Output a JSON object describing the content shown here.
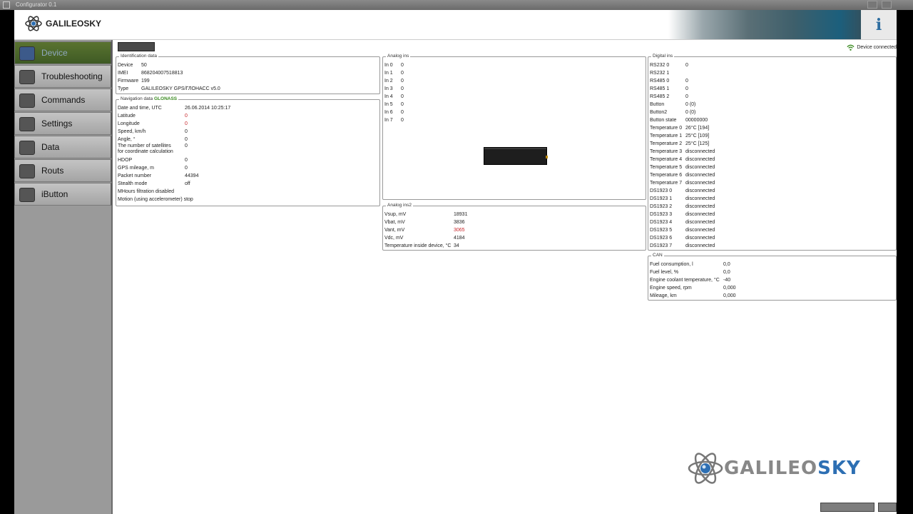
{
  "window": {
    "title": "Configurator 0.1"
  },
  "header": {
    "logo_text": "GALILEOSKY",
    "info_label": "i"
  },
  "sidebar": {
    "items": [
      {
        "label": "Device",
        "icon": "device-icon",
        "active": true
      },
      {
        "label": "Troubleshooting",
        "icon": "troubleshooting-icon"
      },
      {
        "label": "Commands",
        "icon": "commands-icon"
      },
      {
        "label": "Settings",
        "icon": "settings-icon"
      },
      {
        "label": "Data",
        "icon": "data-icon"
      },
      {
        "label": "Routs",
        "icon": "routes-icon"
      },
      {
        "label": "iButton",
        "icon": "ibutton-icon"
      }
    ]
  },
  "status": {
    "text": "Device connected"
  },
  "identification": {
    "title": "Identification data",
    "rows": [
      {
        "k": "Device",
        "v": "50"
      },
      {
        "k": "IMEI",
        "v": "868204007518813"
      },
      {
        "k": "Firmware",
        "v": "199"
      },
      {
        "k": "Type",
        "v": "GALILEOSKY GPS/ГЛОНАСС v5.0"
      }
    ]
  },
  "navigation": {
    "title_prefix": "Navigation data",
    "title_system": "GLONASS",
    "rows": [
      {
        "k": "Date and time, UTC",
        "v": "26.06.2014 10:25:17"
      },
      {
        "k": "Latitude",
        "v": "0",
        "red": true
      },
      {
        "k": "Longitude",
        "v": "0",
        "red": true
      },
      {
        "k": "Speed, km/h",
        "v": "0"
      },
      {
        "k": "Angle, °",
        "v": "0"
      },
      {
        "k1": "The number of satellites",
        "k2": "for coordinate calculation",
        "v": "0",
        "two": true
      },
      {
        "k": "HDOP",
        "v": "0"
      },
      {
        "k": "GPS mileage, m",
        "v": "0"
      },
      {
        "k": "Packet number",
        "v": "44394"
      },
      {
        "k": "Stealth mode",
        "v": "off"
      },
      {
        "k": "MHours filtration disabled",
        "v": ""
      },
      {
        "k": "Motion (using accelerometer) stop",
        "v": ""
      }
    ]
  },
  "analog_ins": {
    "title": "Analog ins",
    "rows": [
      {
        "k": "In 0",
        "v": "0"
      },
      {
        "k": "In 1",
        "v": "0"
      },
      {
        "k": "In 2",
        "v": "0"
      },
      {
        "k": "In 3",
        "v": "0"
      },
      {
        "k": "In 4",
        "v": "0"
      },
      {
        "k": "In 5",
        "v": "0"
      },
      {
        "k": "In 6",
        "v": "0"
      },
      {
        "k": "In 7",
        "v": "0"
      }
    ]
  },
  "analog_ins2": {
    "title": "Analog ins2",
    "rows": [
      {
        "k": "Vsup, mV",
        "v": "18931"
      },
      {
        "k": "Vbat, mV",
        "v": "3836"
      },
      {
        "k": "Vant, mV",
        "v": "3065",
        "red": true
      },
      {
        "k": "Vdc, mV",
        "v": "4184"
      },
      {
        "k": "Temperature inside device, °C",
        "v": "34"
      }
    ]
  },
  "digital_ins": {
    "title": "Digital ins",
    "rows": [
      {
        "k": "RS232 0",
        "v": "0"
      },
      {
        "k": "RS232 1",
        "v": ""
      },
      {
        "k": "RS485 0",
        "v": "0"
      },
      {
        "k": "RS485 1",
        "v": "0"
      },
      {
        "k": "RS485 2",
        "v": "0"
      },
      {
        "k": "Button",
        "v": "0 (0)"
      },
      {
        "k": "Button2",
        "v": "0 (0)"
      },
      {
        "k": "Button state",
        "v": "00000000"
      },
      {
        "k": "Temperature 0",
        "v": "26°C [194]"
      },
      {
        "k": "Temperature 1",
        "v": "25°C [109]"
      },
      {
        "k": "Temperature 2",
        "v": "25°C [125]"
      },
      {
        "k": "Temperature 3",
        "v": "disconnected"
      },
      {
        "k": "Temperature 4",
        "v": "disconnected"
      },
      {
        "k": "Temperature 5",
        "v": "disconnected"
      },
      {
        "k": "Temperature 6",
        "v": "disconnected"
      },
      {
        "k": "Temperature 7",
        "v": "disconnected"
      },
      {
        "k": "DS1923 0",
        "v": "disconnected"
      },
      {
        "k": "DS1923 1",
        "v": "disconnected"
      },
      {
        "k": "DS1923 2",
        "v": "disconnected"
      },
      {
        "k": "DS1923 3",
        "v": "disconnected"
      },
      {
        "k": "DS1923 4",
        "v": "disconnected"
      },
      {
        "k": "DS1923 5",
        "v": "disconnected"
      },
      {
        "k": "DS1923 6",
        "v": "disconnected"
      },
      {
        "k": "DS1923 7",
        "v": "disconnected"
      }
    ]
  },
  "can": {
    "title": "CAN",
    "rows": [
      {
        "k": "Fuel consumption, l",
        "v": "0,0"
      },
      {
        "k": "Fuel level, %",
        "v": "0,0"
      },
      {
        "k": "Engine coolant temperature, °C",
        "v": "-40"
      },
      {
        "k": "Engine speed, rpm",
        "v": "0,000"
      },
      {
        "k": "Mileage, km",
        "v": "0,000"
      }
    ]
  },
  "bottom_logo": {
    "part1": "GALILEO",
    "part2": "SKY"
  }
}
